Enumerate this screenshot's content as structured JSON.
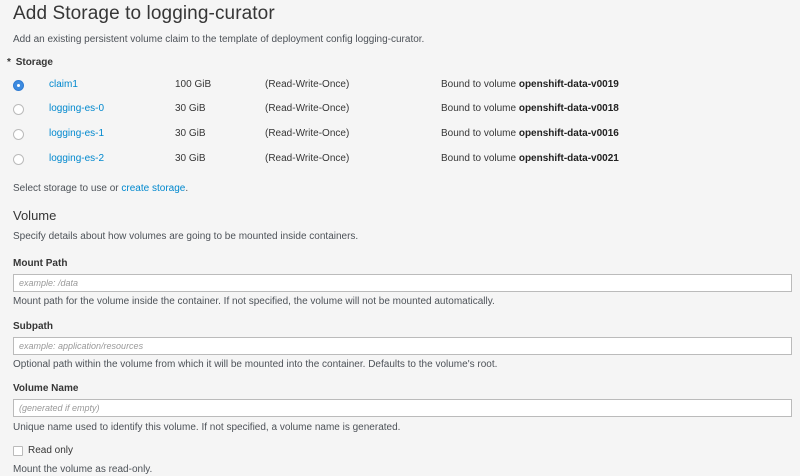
{
  "page": {
    "title": "Add Storage to logging-curator",
    "subtitle": "Add an existing persistent volume claim to the template of deployment config logging-curator."
  },
  "storage": {
    "required_mark": "*",
    "label": "Storage",
    "claims": [
      {
        "name": "claim1",
        "size": "100 GiB",
        "mode": "(Read-Write-Once)",
        "bound_prefix": "Bound to volume",
        "volume": "openshift-data-v0019",
        "selected": true
      },
      {
        "name": "logging-es-0",
        "size": "30 GiB",
        "mode": "(Read-Write-Once)",
        "bound_prefix": "Bound to volume",
        "volume": "openshift-data-v0018",
        "selected": false
      },
      {
        "name": "logging-es-1",
        "size": "30 GiB",
        "mode": "(Read-Write-Once)",
        "bound_prefix": "Bound to volume",
        "volume": "openshift-data-v0016",
        "selected": false
      },
      {
        "name": "logging-es-2",
        "size": "30 GiB",
        "mode": "(Read-Write-Once)",
        "bound_prefix": "Bound to volume",
        "volume": "openshift-data-v0021",
        "selected": false
      }
    ],
    "select_help_prefix": "Select storage to use or",
    "create_link": "create storage",
    "select_help_suffix": "."
  },
  "volume": {
    "title": "Volume",
    "description": "Specify details about how volumes are going to be mounted inside containers.",
    "mount_path": {
      "label": "Mount Path",
      "placeholder": "example: /data",
      "value": "",
      "help": "Mount path for the volume inside the container. If not specified, the volume will not be mounted automatically."
    },
    "subpath": {
      "label": "Subpath",
      "placeholder": "example: application/resources",
      "value": "",
      "help": "Optional path within the volume from which it will be mounted into the container. Defaults to the volume's root."
    },
    "volume_name": {
      "label": "Volume Name",
      "placeholder": "(generated if empty)",
      "value": "",
      "help": "Unique name used to identify this volume. If not specified, a volume name is generated."
    },
    "read_only": {
      "label": "Read only",
      "checked": false,
      "help": "Mount the volume as read-only."
    }
  }
}
